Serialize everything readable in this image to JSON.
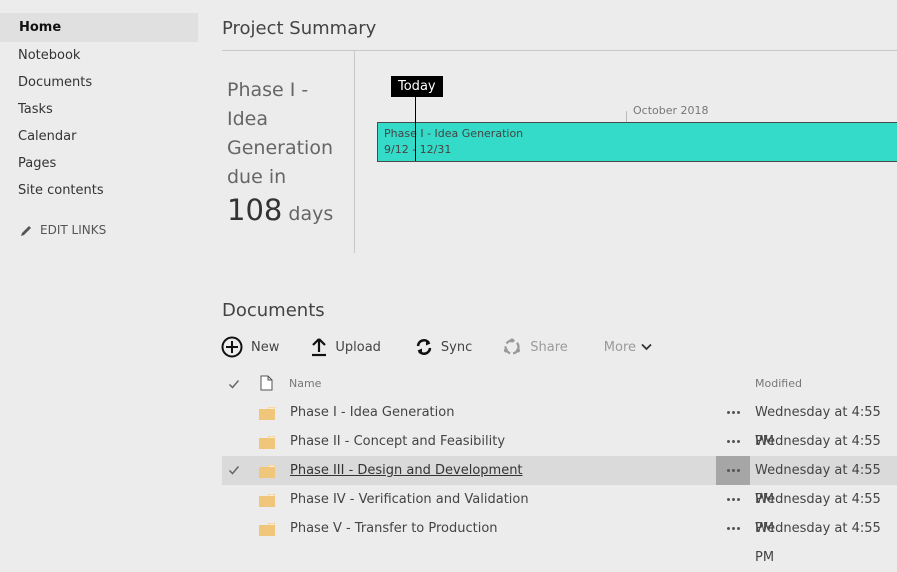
{
  "nav": {
    "items": [
      {
        "label": "Home",
        "active": true
      },
      {
        "label": "Notebook"
      },
      {
        "label": "Documents"
      },
      {
        "label": "Tasks"
      },
      {
        "label": "Calendar"
      },
      {
        "label": "Pages"
      },
      {
        "label": "Site contents"
      }
    ],
    "edit_links": {
      "label": "EDIT LINKS",
      "icon": "pencil-icon"
    }
  },
  "project_summary": {
    "title": "Project Summary",
    "due_text": "Phase I - Idea Generation due in",
    "days_number": "108",
    "days_unit": "days",
    "timeline": {
      "today_label": "Today",
      "month_label": "October 2018",
      "phase": {
        "name": "Phase I - Idea Generation",
        "dates": "9/12 - 12/31",
        "color": "#35dbc9"
      }
    }
  },
  "documents": {
    "title": "Documents",
    "toolbar": [
      {
        "label": "New",
        "icon": "plus-circle-icon",
        "enabled": true
      },
      {
        "label": "Upload",
        "icon": "upload-arrow-icon",
        "enabled": true
      },
      {
        "label": "Sync",
        "icon": "sync-icon",
        "enabled": true
      },
      {
        "label": "Share",
        "icon": "share-icon",
        "enabled": false
      },
      {
        "label": "More",
        "icon": "chevron-down-icon",
        "enabled": false
      }
    ],
    "columns": {
      "select": "check-icon",
      "type": "document-icon",
      "name": "Name",
      "modified": "Modified"
    },
    "rows": [
      {
        "name": "Phase I - Idea Generation",
        "modified": "Wednesday at 4:55 PM",
        "selected": false
      },
      {
        "name": "Phase II - Concept and Feasibility",
        "modified": "Wednesday at 4:55 PM",
        "selected": false
      },
      {
        "name": "Phase III - Design and Development",
        "modified": "Wednesday at 4:55 PM",
        "selected": true
      },
      {
        "name": "Phase IV - Verification and Validation",
        "modified": "Wednesday at 4:55 PM",
        "selected": false
      },
      {
        "name": "Phase V - Transfer to Production",
        "modified": "Wednesday at 4:55 PM",
        "selected": false
      }
    ],
    "folder_color": "#f0c67a"
  }
}
